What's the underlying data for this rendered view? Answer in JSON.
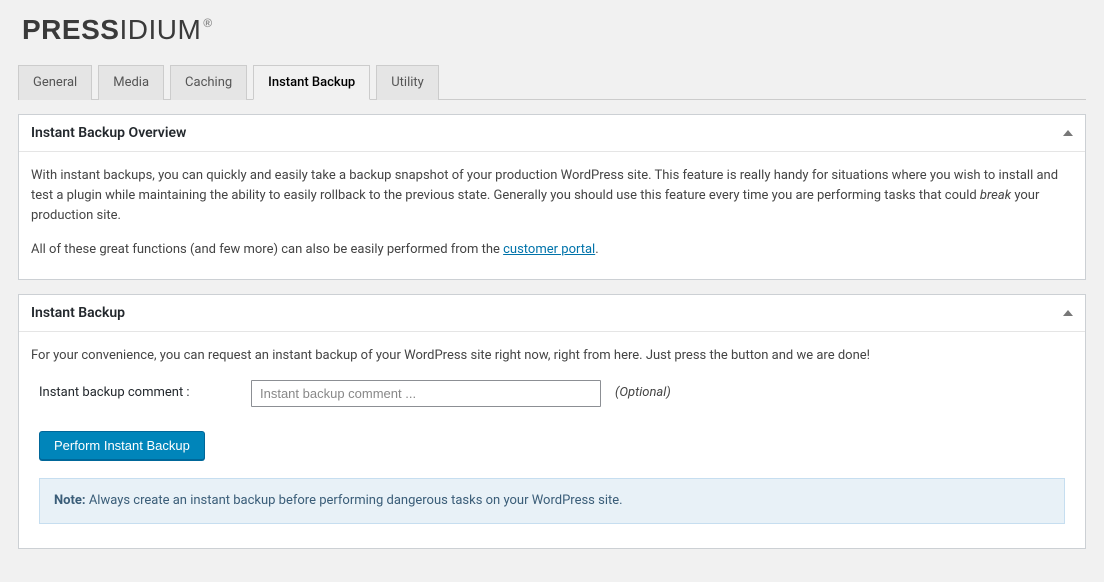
{
  "brand": {
    "bold": "PRESS",
    "thin": "IDIUM",
    "reg": "®"
  },
  "tabs": [
    {
      "label": "General"
    },
    {
      "label": "Media"
    },
    {
      "label": "Caching"
    },
    {
      "label": "Instant Backup"
    },
    {
      "label": "Utility"
    }
  ],
  "active_tab_index": 3,
  "overview": {
    "title": "Instant Backup Overview",
    "p1_a": "With instant backups, you can quickly and easily take a backup snapshot of your production WordPress site. This feature is really handy for situations where you wish to install and test a plugin while maintaining the ability to easily rollback to the previous state. Generally you should use this feature every time you are performing tasks that could ",
    "p1_em": "break",
    "p1_b": " your production site.",
    "p2_a": "All of these great functions (and few more) can also be easily performed from the ",
    "p2_link": "customer portal",
    "p2_b": "."
  },
  "backup": {
    "title": "Instant Backup",
    "intro": "For your convenience, you can request an instant backup of your WordPress site right now, right from here. Just press the button and we are done!",
    "comment_label": "Instant backup comment :",
    "comment_placeholder": "Instant backup comment ...",
    "optional": "(Optional)",
    "button": "Perform Instant Backup",
    "note_label": "Note:",
    "note_text": " Always create an instant backup before performing dangerous tasks on your WordPress site."
  }
}
